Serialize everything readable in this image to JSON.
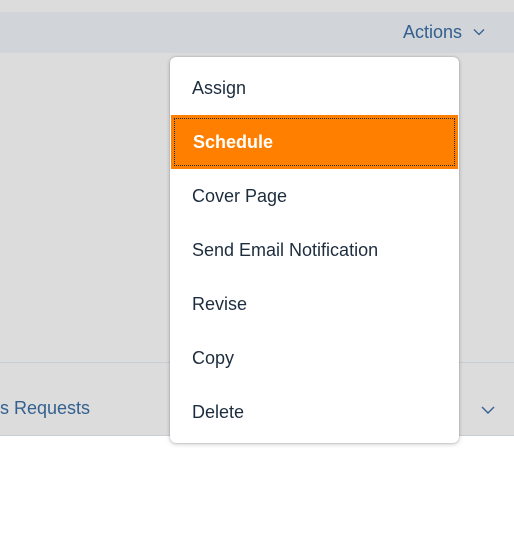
{
  "header": {
    "actions_label": "Actions"
  },
  "menu": {
    "items": [
      {
        "label": "Assign"
      },
      {
        "label": "Schedule"
      },
      {
        "label": "Cover Page"
      },
      {
        "label": "Send Email Notification"
      },
      {
        "label": "Revise"
      },
      {
        "label": "Copy"
      },
      {
        "label": "Delete"
      }
    ],
    "selected_index": 1
  },
  "tabs": {
    "partial_label": "s Requests"
  },
  "colors": {
    "accent": "#ff8000",
    "link": "#33608f",
    "text": "#1d2d3e",
    "background_gray": "#dcdcdd"
  },
  "icons": {
    "actions_dropdown": "chevron-down-icon",
    "tab_dropdown": "chevron-down-icon"
  }
}
